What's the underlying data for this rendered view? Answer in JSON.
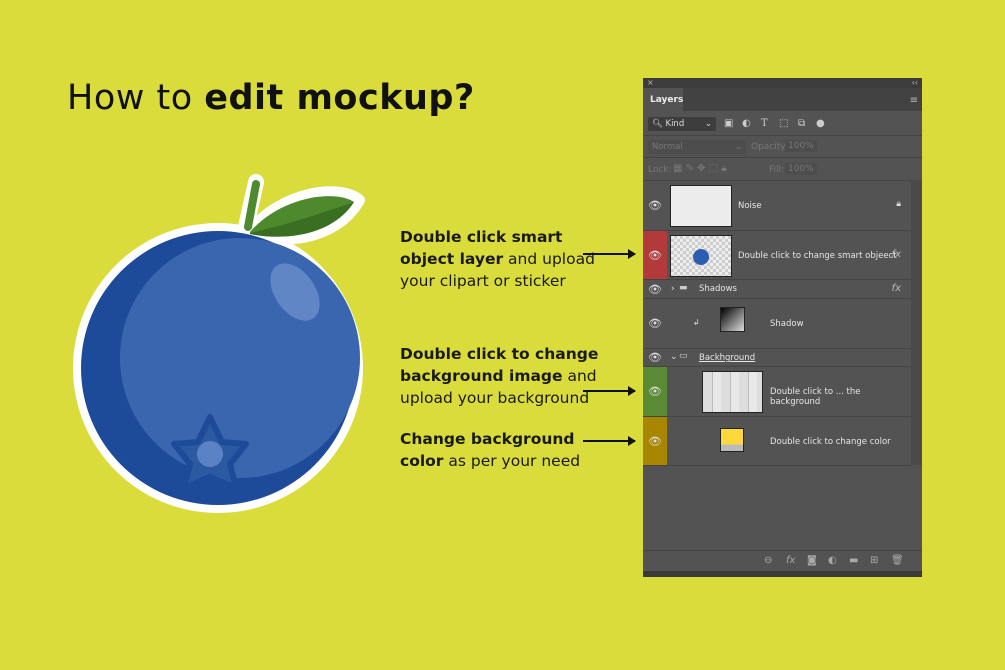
{
  "title": {
    "normal": "How to ",
    "bold": "edit mockup?"
  },
  "instructions": [
    {
      "bold1": "Double click smart",
      "bold2": "object layer",
      "rest2": " and upload",
      "line3": "your clipart or sticker"
    },
    {
      "bold1": "Double click to change",
      "bold2": "background image",
      "rest2": " and",
      "line3": "upload your background"
    },
    {
      "bold1": "Change background",
      "bold2": "color",
      "rest2": " as per your need"
    }
  ],
  "panel": {
    "close": "×",
    "collapse": "‹‹",
    "tab": "Layers",
    "filter_kind": "Kind",
    "blend_mode": "Normal",
    "opacity_label": "Opacity:",
    "opacity_value": "100%",
    "lock_label": "Lock:",
    "fill_label": "Fill:",
    "fill_value": "100%",
    "fx": "fx",
    "layers": [
      {
        "name": "Noise",
        "color": "#535353"
      },
      {
        "name": "Double click to change smart objeect",
        "color": "#b23a3a"
      },
      {
        "name": "Shadows",
        "color": "#535353"
      },
      {
        "name": "Shadow",
        "color": "#535353"
      },
      {
        "name": "Backhground",
        "color": "#535353"
      },
      {
        "name": "Double click to ... the background",
        "color": "#5a8a33"
      },
      {
        "name": "Double click to change color",
        "color": "#a88600"
      }
    ]
  },
  "colors": {
    "background": "#d9dc3a",
    "berry": "#3a66b0",
    "fill_swatch": "#ffd93b"
  }
}
